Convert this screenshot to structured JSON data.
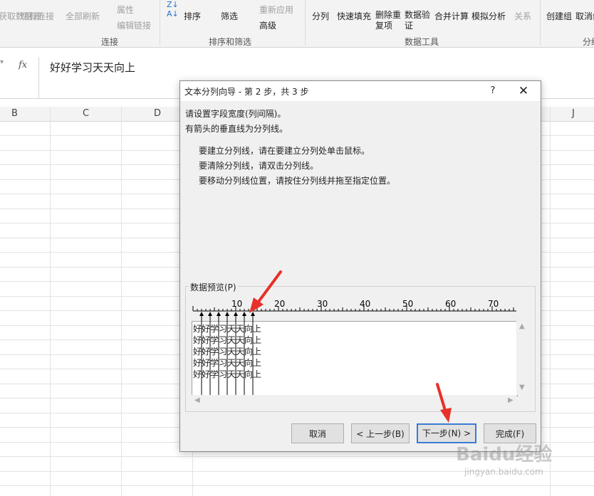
{
  "ribbon": {
    "items": [
      {
        "label": "获取数据源"
      },
      {
        "label": "现有连接"
      },
      {
        "label": "全部刷新"
      },
      {
        "label": "属性"
      },
      {
        "label": "编辑链接"
      },
      {
        "label": "排序"
      },
      {
        "label": "筛选"
      },
      {
        "label": "重新应用"
      },
      {
        "label": "高级"
      },
      {
        "label": "分列"
      },
      {
        "label": "快速填充"
      },
      {
        "label": "删除重复项"
      },
      {
        "label": "数据验证"
      },
      {
        "label": "合并计算"
      },
      {
        "label": "模拟分析"
      },
      {
        "label": "关系"
      },
      {
        "label": "创建组"
      },
      {
        "label": "取消组合"
      }
    ],
    "groups": [
      "连接",
      "排序和筛选",
      "数据工具",
      "分级显示"
    ],
    "icons": [
      "sort-az-icon",
      "filter-icon",
      "text-to-columns-icon"
    ]
  },
  "formula_bar": {
    "fx_label": "fx",
    "content": "好好学习天天向上"
  },
  "columns": [
    "B",
    "C",
    "D",
    "J"
  ],
  "dialog": {
    "title": "文本分列向导 - 第 2 步，共 3 步",
    "help_label": "?",
    "close_label": "✕",
    "intro_line1": "请设置字段宽度(列间隔)。",
    "intro_line2": "有箭头的垂直线为分列线。",
    "hint1": "要建立分列线，请在要建立分列处单击鼠标。",
    "hint2": "要清除分列线，请双击分列线。",
    "hint3": "要移动分列线位置，请按住分列线并拖至指定位置。",
    "preview_label": "数据预览(P)",
    "ruler_ticks": [
      "10",
      "20",
      "30",
      "40",
      "50",
      "60",
      "70"
    ],
    "preview_rows": [
      "好好学习天天向上",
      "好好学习天天向上",
      "好好学习天天向上",
      "好好学习天天向上",
      "好好学习天天向上"
    ],
    "buttons": {
      "cancel": "取消",
      "back": "< 上一步(B)",
      "next": "下一步(N) >",
      "finish": "完成(F)"
    }
  },
  "watermark": {
    "logo": "Baidu经验",
    "url": "jingyan.baidu.com"
  },
  "colors": {
    "annotation_red": "#e8302a",
    "dialog_bg": "#f0f0f0",
    "primary_border": "#3a7bd5"
  }
}
